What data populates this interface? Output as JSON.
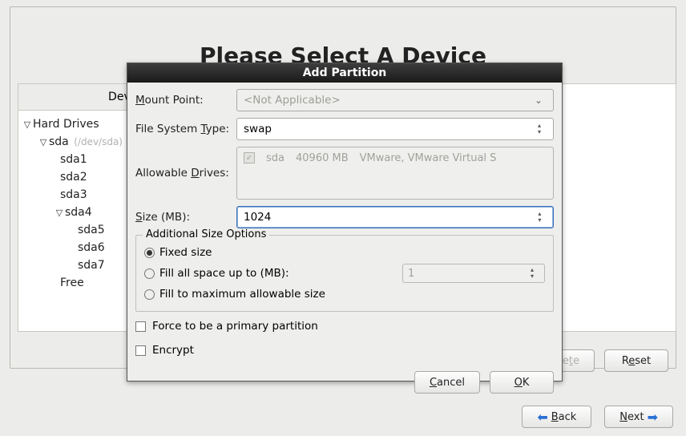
{
  "page": {
    "title": "Please Select A Device"
  },
  "tree": {
    "header": "Device",
    "root": "Hard Drives",
    "disk": {
      "name": "sda",
      "path": "(/dev/sda)"
    },
    "parts": [
      "sda1",
      "sda2",
      "sda3",
      "sda4",
      "sda5",
      "sda6",
      "sda7"
    ],
    "free": "Free"
  },
  "footer_buttons": {
    "delete": "Delete",
    "reset": "Reset"
  },
  "nav": {
    "back": "Back",
    "next": "Next"
  },
  "modal": {
    "title": "Add Partition",
    "labels": {
      "mount_point": "Mount Point:",
      "fs_type": "File System Type:",
      "allowable_drives": "Allowable Drives:",
      "size": "Size (MB):"
    },
    "mount_point_value": "<Not Applicable>",
    "fs_type_value": "swap",
    "drive": {
      "name": "sda",
      "size": "40960 MB",
      "desc": "VMware, VMware Virtual S"
    },
    "size_value": "1024",
    "size_options": {
      "legend": "Additional Size Options",
      "fixed": "Fixed size",
      "fill_up_to": "Fill all space up to (MB):",
      "fill_up_to_value": "1",
      "fill_max": "Fill to maximum allowable size",
      "selected": "fixed"
    },
    "checks": {
      "primary": "Force to be a primary partition",
      "encrypt": "Encrypt"
    },
    "actions": {
      "cancel": "Cancel",
      "ok": "OK"
    }
  }
}
